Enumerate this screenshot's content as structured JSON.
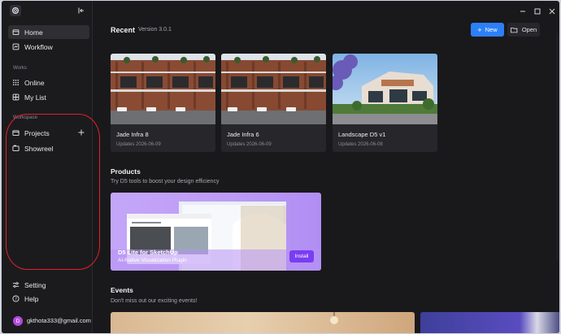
{
  "sidebar": {
    "items": [
      {
        "label": "Home",
        "icon": "home-icon"
      },
      {
        "label": "Workflow",
        "icon": "workflow-icon"
      }
    ],
    "works_label": "Works",
    "works_items": [
      {
        "label": "Online",
        "icon": "grid-icon"
      },
      {
        "label": "My List",
        "icon": "list-icon"
      }
    ],
    "workspace_label": "Workspace",
    "workspace_items": [
      {
        "label": "Projects",
        "icon": "folder-icon"
      },
      {
        "label": "Showreel",
        "icon": "showreel-icon"
      }
    ],
    "setting_label": "Setting",
    "help_label": "Help",
    "user": {
      "initial": "D",
      "email": "gkthota333@gmail.com"
    }
  },
  "recent": {
    "title": "Recent",
    "version": "Version 3.0.1",
    "new_label": "New",
    "open_label": "Open",
    "cards": [
      {
        "title": "Jade Infra 8",
        "date": "Updates 2026-06-09"
      },
      {
        "title": "Jade Infra 6",
        "date": "Updates 2026-06-09"
      },
      {
        "title": "Landscape D5 v1",
        "date": "Updates 2026-06-08"
      }
    ]
  },
  "products": {
    "title": "Products",
    "subtitle": "Try D5 tools to boost your design efficiency",
    "banner": {
      "title": "D5 Lite for SketchUp",
      "subtitle": "AI-Native Visualization Plugin",
      "install_label": "Install"
    }
  },
  "events": {
    "title": "Events",
    "subtitle": "Don't miss out our exciting events!"
  },
  "colors": {
    "accent": "#2d7ff9",
    "install": "#7a3df2",
    "annotation": "#e3202a"
  }
}
